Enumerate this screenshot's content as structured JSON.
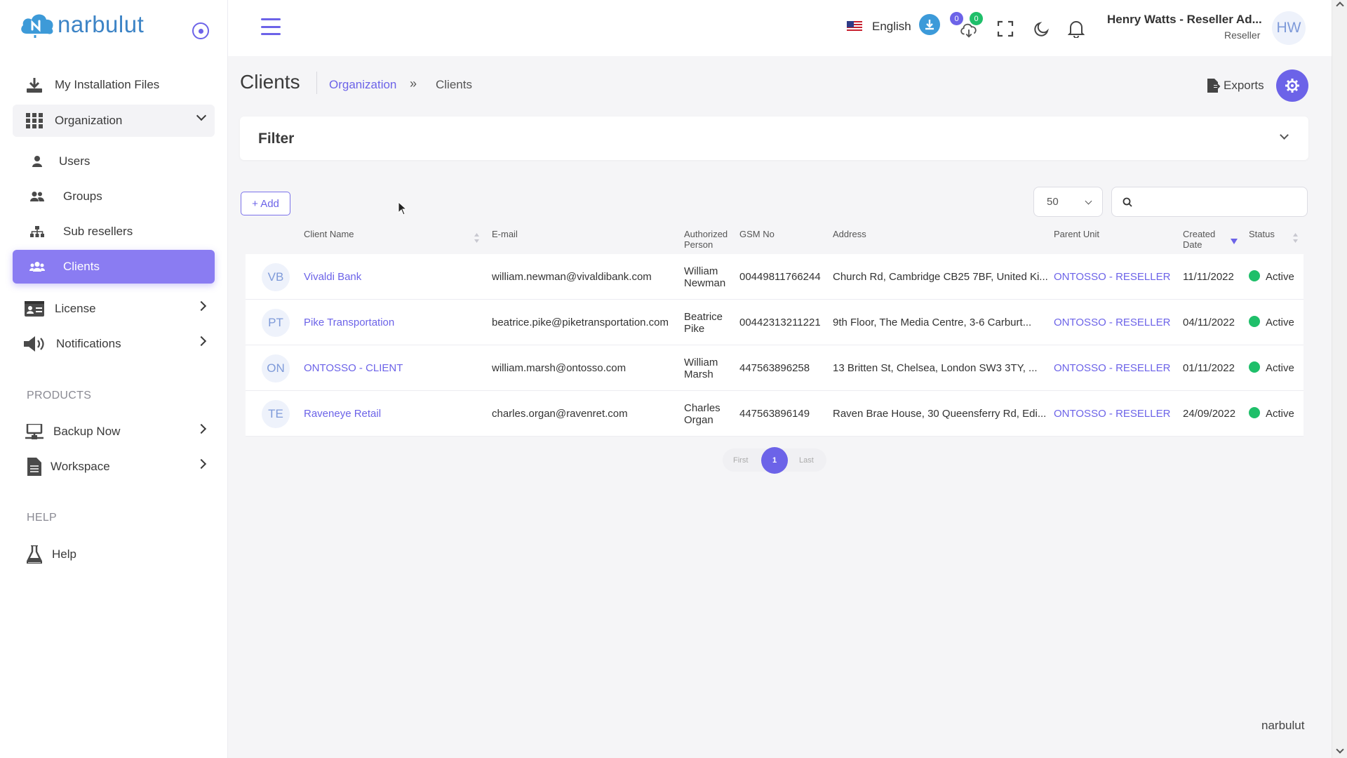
{
  "brand": {
    "name": "narbulut",
    "footer": "narbulut"
  },
  "sidebar": {
    "items": [
      {
        "label": "My Installation Files",
        "icon": "download-tray-icon"
      },
      {
        "label": "Organization",
        "icon": "grid-icon"
      },
      {
        "label": "Users",
        "icon": "user-icon"
      },
      {
        "label": "Groups",
        "icon": "group-icon"
      },
      {
        "label": "Sub resellers",
        "icon": "sitemap-icon"
      },
      {
        "label": "Clients",
        "icon": "clients-icon"
      },
      {
        "label": "License",
        "icon": "id-card-icon"
      },
      {
        "label": "Notifications",
        "icon": "megaphone-icon"
      },
      {
        "label": "Backup Now",
        "icon": "network-icon"
      },
      {
        "label": "Workspace",
        "icon": "file-icon"
      },
      {
        "label": "Help",
        "icon": "flask-icon"
      }
    ],
    "sections": {
      "products": "PRODUCTS",
      "help": "HELP"
    }
  },
  "topbar": {
    "language": "English",
    "badge_left": "0",
    "badge_right": "0",
    "user_name": "Henry Watts - Reseller Ad...",
    "user_role": "Reseller",
    "avatar_initials": "HW"
  },
  "header": {
    "title": "Clients",
    "breadcrumb_link": "Organization",
    "breadcrumb_sep": "»",
    "breadcrumb_current": "Clients",
    "exports_label": "Exports"
  },
  "filter": {
    "title": "Filter"
  },
  "toolbar": {
    "add_label": "+ Add",
    "per_page": "50",
    "search_placeholder": ""
  },
  "table": {
    "columns": [
      "Client Name",
      "E-mail",
      "Authorized Person",
      "GSM No",
      "Address",
      "Parent Unit",
      "Created Date",
      "Status"
    ],
    "rows": [
      {
        "initials": "VB",
        "name": "Vivaldi Bank",
        "email": "william.newman@vivaldibank.com",
        "person": "William Newman",
        "gsm": "00449811766244",
        "address": "Church Rd, Cambridge CB25 7BF, United Ki...",
        "parent": "ONTOSSO - RESELLER",
        "date": "11/11/2022",
        "status": "Active"
      },
      {
        "initials": "PT",
        "name": "Pike Transportation",
        "email": "beatrice.pike@piketransportation.com",
        "person": "Beatrice Pike",
        "gsm": "00442313211221",
        "address": "9th Floor, The Media Centre, 3-6 Carburt...",
        "parent": "ONTOSSO - RESELLER",
        "date": "04/11/2022",
        "status": "Active"
      },
      {
        "initials": "ON",
        "name": "ONTOSSO - CLIENT",
        "email": "william.marsh@ontosso.com",
        "person": "William Marsh",
        "gsm": "447563896258",
        "address": "13 Britten St, Chelsea, London SW3 3TY, ...",
        "parent": "ONTOSSO - RESELLER",
        "date": "01/11/2022",
        "status": "Active"
      },
      {
        "initials": "TE",
        "name": "Raveneye Retail",
        "email": "charles.organ@ravenret.com",
        "person": "Charles Organ",
        "gsm": "447563896149",
        "address": "Raven Brae House, 30 Queensferry Rd, Edi...",
        "parent": "ONTOSSO - RESELLER",
        "date": "24/09/2022",
        "status": "Active"
      }
    ]
  },
  "pagination": {
    "first": "First",
    "current": "1",
    "last": "Last"
  },
  "colors": {
    "accent": "#6c63e8",
    "active_item": "#8a7cf2",
    "status_active": "#1fbf6a",
    "logo": "#3d84c6"
  }
}
